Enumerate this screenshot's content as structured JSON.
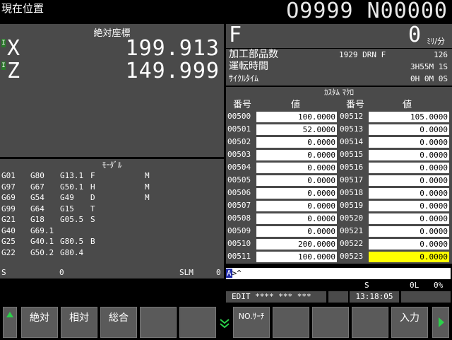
{
  "header": {
    "title": "現在位置",
    "program": "O9999 N00000"
  },
  "absolute": {
    "title": "絶対座標",
    "axes": [
      {
        "flag": "I",
        "name": "X",
        "value": "199.913"
      },
      {
        "flag": "I",
        "name": "Z",
        "value": "149.999"
      }
    ]
  },
  "feed": {
    "letter": "F",
    "value": "0",
    "unit": "ﾐﾘ/分"
  },
  "info": {
    "parts_label": "加工部品数",
    "parts_prog": "1929 DRN F",
    "parts_count": "126",
    "runtime_label": "運転時間",
    "runtime_value": "3H55M 1S",
    "cycle_label": "ｻｲｸﾙﾀｲﾑ",
    "cycle_value": "0H 0M 0S"
  },
  "macro": {
    "title": "ｶｽﾀﾑ ﾏｸﾛ",
    "col_num": "番号",
    "col_val": "値",
    "left": [
      {
        "num": "00500",
        "val": "100.0000"
      },
      {
        "num": "00501",
        "val": "52.0000"
      },
      {
        "num": "00502",
        "val": "0.0000"
      },
      {
        "num": "00503",
        "val": "0.0000"
      },
      {
        "num": "00504",
        "val": "0.0000"
      },
      {
        "num": "00505",
        "val": "0.0000"
      },
      {
        "num": "00506",
        "val": "0.0000"
      },
      {
        "num": "00507",
        "val": "0.0000"
      },
      {
        "num": "00508",
        "val": "0.0000"
      },
      {
        "num": "00509",
        "val": "0.0000"
      },
      {
        "num": "00510",
        "val": "200.0000"
      },
      {
        "num": "00511",
        "val": "100.0000"
      }
    ],
    "right": [
      {
        "num": "00512",
        "val": "105.0000"
      },
      {
        "num": "00513",
        "val": "0.0000"
      },
      {
        "num": "00514",
        "val": "0.0000"
      },
      {
        "num": "00515",
        "val": "0.0000"
      },
      {
        "num": "00516",
        "val": "0.0000"
      },
      {
        "num": "00517",
        "val": "0.0000"
      },
      {
        "num": "00518",
        "val": "0.0000"
      },
      {
        "num": "00519",
        "val": "0.0000"
      },
      {
        "num": "00520",
        "val": "0.0000"
      },
      {
        "num": "00521",
        "val": "0.0000"
      },
      {
        "num": "00522",
        "val": "0.0000"
      },
      {
        "num": "00523",
        "val": "0.0000"
      }
    ]
  },
  "modal": {
    "title": "ﾓｰﾀﾞﾙ",
    "rows": [
      [
        "G01",
        "G80",
        "G13.1",
        "F",
        "M"
      ],
      [
        "G97",
        "G67",
        "G50.1",
        "H",
        "M"
      ],
      [
        "G69",
        "G54",
        "G49",
        "D",
        "M"
      ],
      [
        "G99",
        "G64",
        "G15",
        "T",
        ""
      ],
      [
        "G21",
        "G18",
        "G05.5",
        "S",
        ""
      ],
      [
        "G40",
        "G69.1",
        "",
        "",
        ""
      ],
      [
        "G25",
        "G40.1",
        "G80.5",
        "B",
        ""
      ],
      [
        "G22",
        "G50.2",
        "G80.4",
        "",
        ""
      ]
    ]
  },
  "status": {
    "s_label": "S",
    "s_value": "0",
    "slm_label": "SLM",
    "slm_value": "0",
    "input_prompt": "A",
    "input_text": ">^",
    "s2_label": "S",
    "l_value": "0L",
    "percent": "0%",
    "mode": "EDIT **** *** ***",
    "time": "13:18:05"
  },
  "softkeys": {
    "absolute": "絶対",
    "relative": "相対",
    "all": "総合",
    "no_search": "NO.ｻｰﾁ",
    "input": "入力"
  }
}
